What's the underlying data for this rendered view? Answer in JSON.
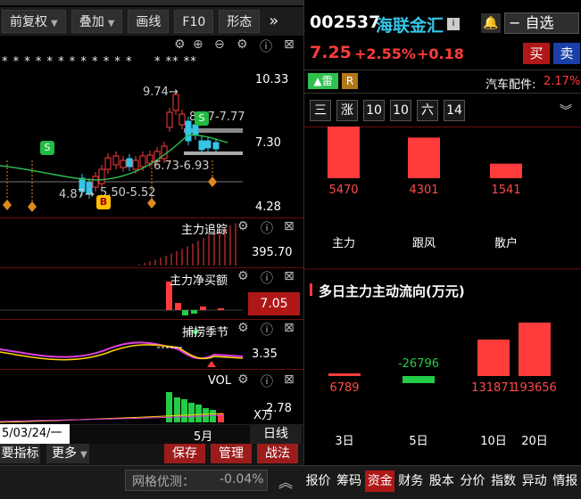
{
  "toolbar": {
    "fuquan": "前复权",
    "overlay": "叠加",
    "draw": "画线",
    "f10": "F10",
    "shape": "形态",
    "more": "»"
  },
  "stock": {
    "code": "002537",
    "name": "海联金汇",
    "price": "7.25",
    "change_pct": "+2.55%",
    "change": "+0.18",
    "buy": "买",
    "sell": "卖",
    "watchlist": "自选",
    "thunder": "雷",
    "r_badge": "R",
    "sector_label": "汽车配件:",
    "sector_pct": "2.17%"
  },
  "period_buttons": [
    "三",
    "涨",
    "10",
    "10",
    "六",
    "14"
  ],
  "kline": {
    "price_high": "10.33",
    "price_mid": "7.30",
    "price_low": "4.28",
    "ann_high": "9.74→",
    "ann_range1": "8.57-7.77",
    "ann_range2": "6.73-6.93",
    "ann_low": "4.87→",
    "ann_range3": "5.50-5.52",
    "s_mark": "S",
    "b_mark": "B",
    "stars": "* * *   * * * *   * * * * *",
    "stars2": "*   ** **"
  },
  "panels": {
    "tracking_label": "主力追踪",
    "tracking_value": "395.70",
    "netbuy_label": "主力净买额",
    "netbuy_value": "7.05",
    "season_label": "捕捞季节",
    "season_value": "3.35",
    "vol_label": "VOL",
    "vol_value": "2.78",
    "vol_unit": "X万"
  },
  "timeline": {
    "date": "5/03/24/一",
    "month": "5月",
    "daily": "日线"
  },
  "bottom": {
    "more_indicators": "要指标",
    "more": "更多",
    "save": "保存",
    "manage": "管理",
    "strategy": "战法",
    "grid_label": "网格优测：",
    "grid_value": "-0.04%",
    "expand": "︽"
  },
  "capital": {
    "chart_title": "多日主力主动流向(万元)",
    "groups": [
      "主力",
      "跟风",
      "散户"
    ],
    "group_values": [
      5470,
      4301,
      1541
    ],
    "days": [
      "3日",
      "5日",
      "10日",
      "20日"
    ],
    "day_values": [
      6789,
      -26796,
      131871,
      193656
    ]
  },
  "chart_data": [
    {
      "type": "bar",
      "categories": [
        "主力",
        "跟风",
        "散户"
      ],
      "values": [
        5470,
        4301,
        1541
      ],
      "title": ""
    },
    {
      "type": "bar",
      "categories": [
        "3日",
        "5日",
        "10日",
        "20日"
      ],
      "values": [
        6789,
        -26796,
        131871,
        193656
      ],
      "title": "多日主力主动流向(万元)"
    }
  ],
  "bottom_tabs": [
    "报价",
    "筹码",
    "资金",
    "财务",
    "股本",
    "分价",
    "指数",
    "异动",
    "情报"
  ],
  "active_tab": "资金",
  "colors": {
    "up": "#ff3b3b",
    "down": "#22cc44",
    "cyan": "#35c6e8",
    "yellow": "#ffd400"
  }
}
